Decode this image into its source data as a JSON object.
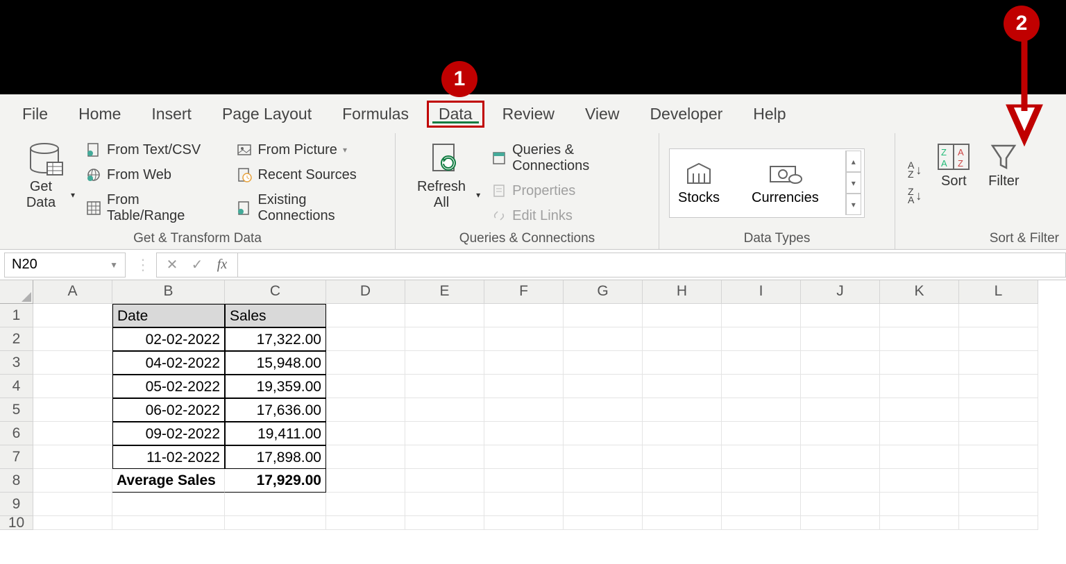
{
  "callouts": {
    "one": "1",
    "two": "2"
  },
  "tabs": [
    "File",
    "Home",
    "Insert",
    "Page Layout",
    "Formulas",
    "Data",
    "Review",
    "View",
    "Developer",
    "Help"
  ],
  "ribbon": {
    "getData": "Get Data",
    "fromTextCSV": "From Text/CSV",
    "fromWeb": "From Web",
    "fromTableRange": "From Table/Range",
    "fromPicture": "From Picture",
    "recentSources": "Recent Sources",
    "existingConnections": "Existing Connections",
    "groupGetTransform": "Get & Transform Data",
    "refreshAll": "Refresh All",
    "queriesConnections": "Queries & Connections",
    "properties": "Properties",
    "editLinks": "Edit Links",
    "groupQueries": "Queries & Connections",
    "stocks": "Stocks",
    "currencies": "Currencies",
    "groupDataTypes": "Data Types",
    "sort": "Sort",
    "filter": "Filter",
    "groupSortFilter": "Sort & Filter",
    "sortAZ": "A→Z",
    "sortZA": "Z→A"
  },
  "nameBox": "N20",
  "columns": [
    "A",
    "B",
    "C",
    "D",
    "E",
    "F",
    "G",
    "H",
    "I",
    "J",
    "K",
    "L"
  ],
  "rowNums": [
    "1",
    "2",
    "3",
    "4",
    "5",
    "6",
    "7",
    "8",
    "9",
    "10"
  ],
  "sheet": {
    "headerDate": "Date",
    "headerSales": "Sales",
    "rows": [
      {
        "date": "02-02-2022",
        "sales": "17,322.00"
      },
      {
        "date": "04-02-2022",
        "sales": "15,948.00"
      },
      {
        "date": "05-02-2022",
        "sales": "19,359.00"
      },
      {
        "date": "06-02-2022",
        "sales": "17,636.00"
      },
      {
        "date": "09-02-2022",
        "sales": "19,411.00"
      },
      {
        "date": "11-02-2022",
        "sales": "17,898.00"
      }
    ],
    "avgLabel": "Average Sales",
    "avgValue": "17,929.00"
  }
}
